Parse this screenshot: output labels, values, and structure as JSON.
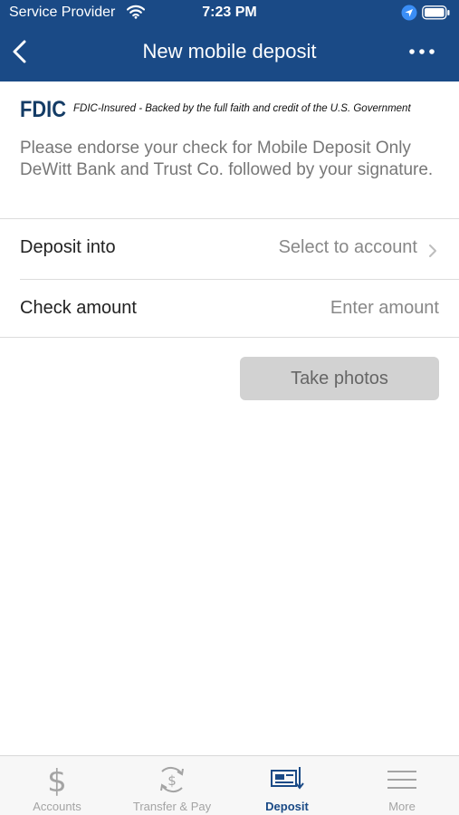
{
  "status_bar": {
    "carrier": "Service Provider",
    "time": "7:23 PM"
  },
  "nav": {
    "title": "New mobile deposit"
  },
  "fdic": {
    "logo_text": "FDIC",
    "tagline": "FDIC-Insured - Backed by the full faith and credit of the U.S. Government"
  },
  "instructions": "Please endorse your check for Mobile Deposit Only DeWitt Bank and Trust Co. followed by your signature.",
  "form": {
    "deposit_into_label": "Deposit into",
    "deposit_into_value": "Select to account",
    "check_amount_label": "Check amount",
    "check_amount_placeholder": "Enter amount"
  },
  "take_photos_label": "Take photos",
  "tabs": [
    {
      "label": "Accounts",
      "icon": "dollar-icon"
    },
    {
      "label": "Transfer & Pay",
      "icon": "transfer-pay-icon"
    },
    {
      "label": "Deposit",
      "icon": "check-deposit-icon"
    },
    {
      "label": "More",
      "icon": "hamburger-menu-icon"
    }
  ],
  "colors": {
    "primary": "#1a4a86",
    "inactive_tab": "#a4a4a4",
    "button_disabled": "#d2d2d2"
  },
  "active_tab": "Deposit"
}
